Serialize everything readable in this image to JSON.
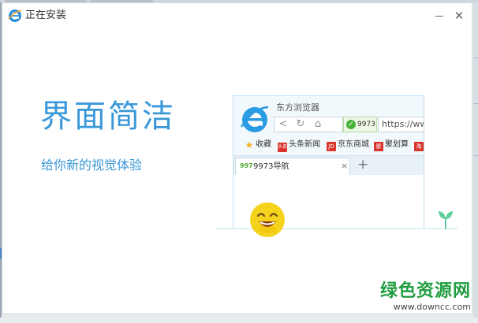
{
  "window": {
    "title": "正在安装",
    "minimize_label": "—",
    "close_label": "✕"
  },
  "slide": {
    "headline": "界面简洁",
    "subtitle": "给你新的视觉体验"
  },
  "mock_browser": {
    "brand": "东方浏览器",
    "nav": {
      "back": "<",
      "reload": "↻",
      "home": "⌂"
    },
    "safety_badge": "9973",
    "url": "https://www",
    "bookmarks": [
      {
        "label": "收藏",
        "icon": "star-icon",
        "color": "#f2b01e"
      },
      {
        "label": "头条新闻",
        "icon": "news-icon",
        "color": "#d9342b",
        "glyph": "头条"
      },
      {
        "label": "京东商城",
        "icon": "jd-icon",
        "color": "#d9342b",
        "glyph": "JD"
      },
      {
        "label": "聚划算",
        "icon": "juhuasuan-icon",
        "color": "#d9342b",
        "glyph": "聚"
      },
      {
        "label": "",
        "icon": "extra-site-icon",
        "color": "#d9342b",
        "glyph": "淘"
      }
    ],
    "tab": {
      "favicon_text": "997",
      "label": "9973导航",
      "close": "×"
    },
    "new_tab": "+"
  },
  "watermark": {
    "text": "绿色资源网",
    "url": "www.downcc.com"
  },
  "colors": {
    "accent": "#3a98d8",
    "watermark_green": "#1f9d3e",
    "smiley_yellow": "#f5d31c",
    "sprout_green": "#5ccf9b"
  }
}
